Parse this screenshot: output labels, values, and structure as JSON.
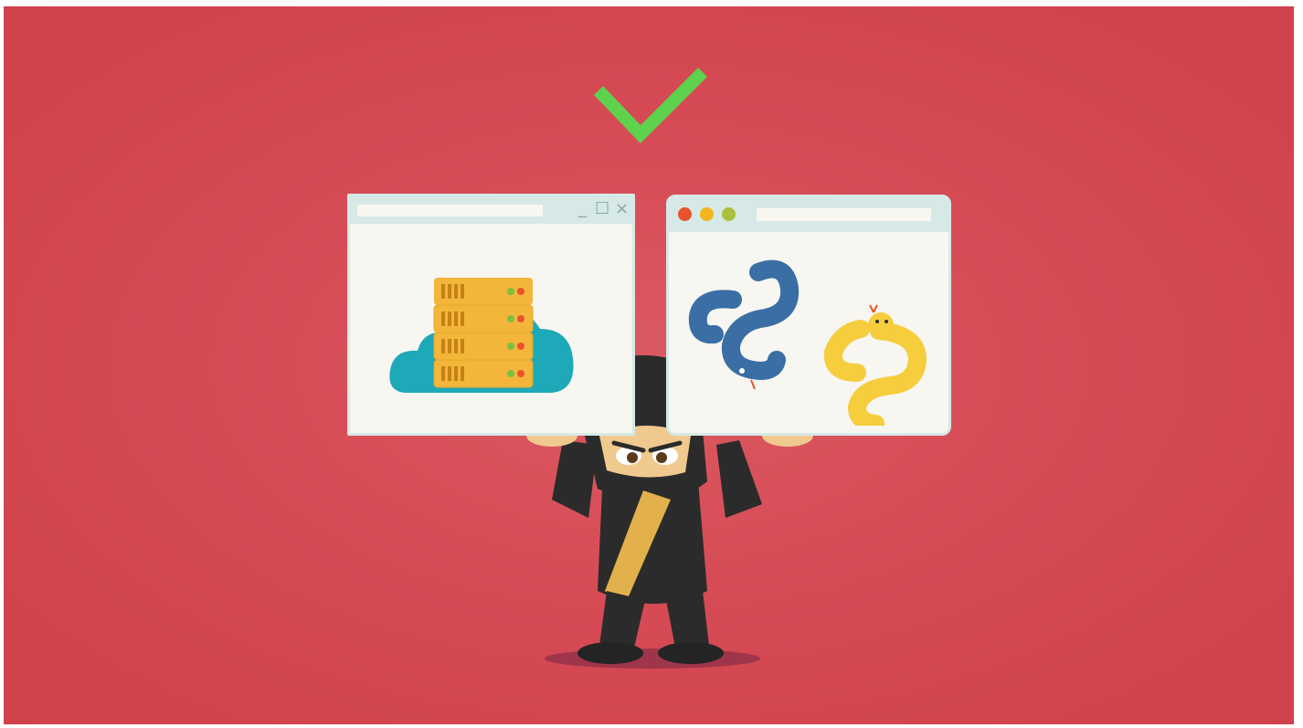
{
  "scene": {
    "background_color": "#d44b55",
    "check_color": "#5fd24d",
    "left_window": {
      "icon": "cloud-server-icon",
      "controls": {
        "minimize": "_",
        "maximize": "☐",
        "close": "×"
      }
    },
    "right_window": {
      "icon": "python-snakes-icon",
      "traffic_lights": [
        "#e8542b",
        "#f2b51a",
        "#a9c13a"
      ]
    },
    "character": "ninja-mascot"
  }
}
